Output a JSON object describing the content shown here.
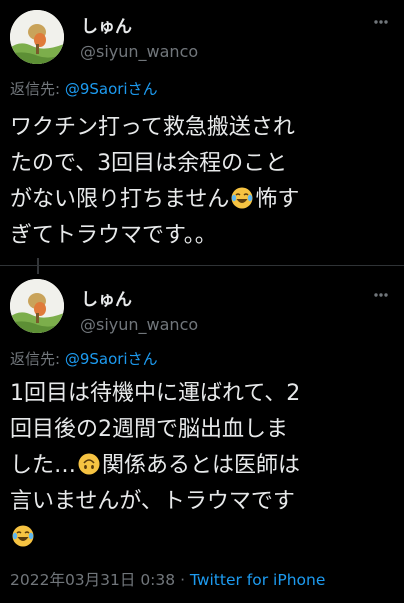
{
  "tweets": [
    {
      "display_name": "しゅん",
      "handle": "@siyun_wanco",
      "reply_prefix": "返信先: ",
      "reply_mention": "@9Saori",
      "reply_suffix": "さん",
      "lines": [
        "ワクチン打って救急搬送され",
        "たので、3回目は余程のこと",
        "がない限り打ちません",
        "怖す",
        "ぎてトラウマです。。"
      ],
      "emojis": [
        "face-with-tears-of-joy-icon"
      ]
    },
    {
      "display_name": "しゅん",
      "handle": "@siyun_wanco",
      "reply_prefix": "返信先: ",
      "reply_mention": "@9Saori",
      "reply_suffix": "さん",
      "lines": [
        "1回目は待機中に運ばれて、2",
        "回目後の2週間で脳出血しま",
        "した…",
        "関係あるとは医師は",
        "言いませんが、トラウマです"
      ],
      "emojis": [
        "upside-down-face-icon",
        "face-with-tears-of-joy-icon"
      ],
      "timestamp": "2022年03月31日 0:38",
      "separator": " · ",
      "source": "Twitter for iPhone"
    }
  ],
  "colors": {
    "background": "#000000",
    "text": "#e7e9ea",
    "secondary": "#71767b",
    "link": "#1d9bf0",
    "emoji": "#f6c342"
  }
}
